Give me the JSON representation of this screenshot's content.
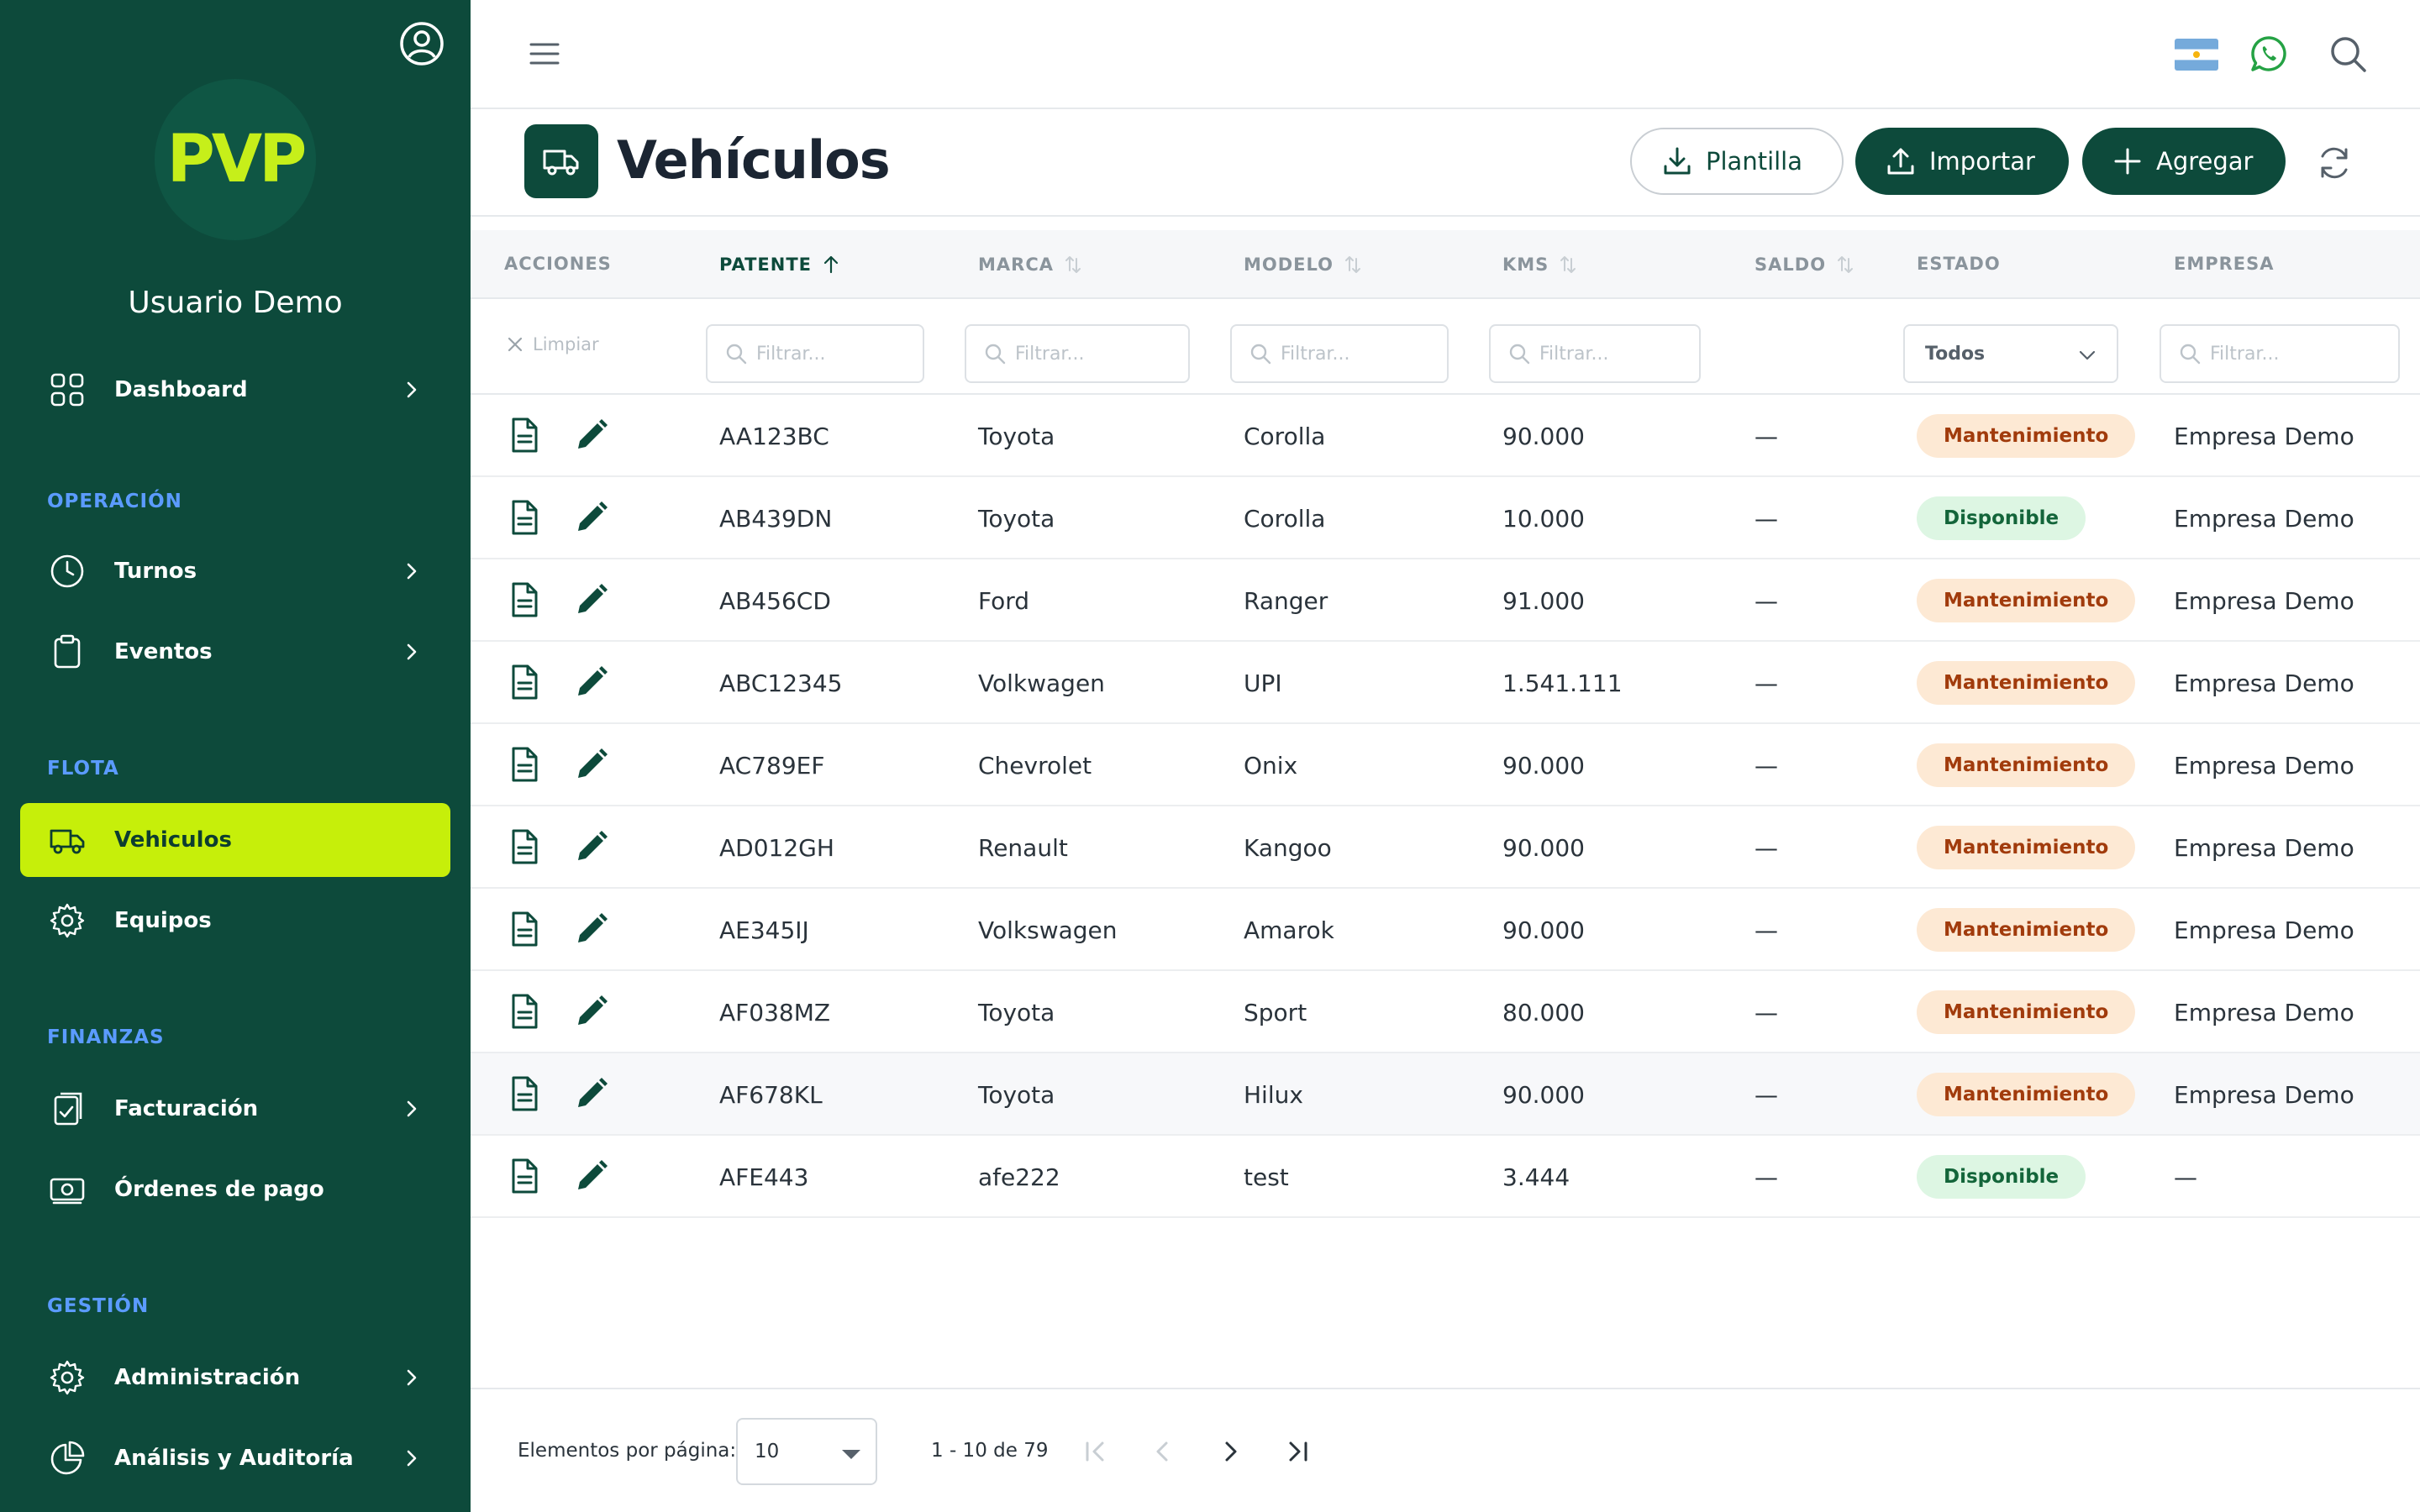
{
  "sidebar": {
    "logo_text": "PVP",
    "username": "Usuario Demo",
    "sections": {
      "operacion": "OPERACIÓN",
      "flota": "FLOTA",
      "finanzas": "FINANZAS",
      "gestion": "GESTIÓN"
    },
    "items": [
      {
        "label": "Dashboard",
        "icon": "grid-icon",
        "chevron": true
      },
      {
        "label": "Turnos",
        "icon": "clock-icon",
        "chevron": true
      },
      {
        "label": "Eventos",
        "icon": "clipboard-icon",
        "chevron": true
      },
      {
        "label": "Vehiculos",
        "icon": "truck-icon",
        "chevron": false,
        "active": true
      },
      {
        "label": "Equipos",
        "icon": "gear-icon",
        "chevron": false
      },
      {
        "label": "Facturación",
        "icon": "invoice-icon",
        "chevron": true
      },
      {
        "label": "Órdenes de pago",
        "icon": "money-icon",
        "chevron": false
      },
      {
        "label": "Administración",
        "icon": "gear-icon",
        "chevron": true
      },
      {
        "label": "Análisis y Auditoría",
        "icon": "pie-chart-icon",
        "chevron": true
      }
    ]
  },
  "header": {
    "title": "Vehículos",
    "buttons": {
      "plantilla": "Plantilla",
      "importar": "Importar",
      "agregar": "Agregar"
    }
  },
  "table": {
    "columns": {
      "acciones": "ACCIONES",
      "patente": "PATENTE",
      "marca": "MARCA",
      "modelo": "MODELO",
      "kms": "KMS",
      "saldo": "SALDO",
      "estado": "ESTADO",
      "empresa": "EMPRESA"
    },
    "filters": {
      "clear": "Limpiar",
      "placeholder": "Filtrar...",
      "estado_selected": "Todos"
    },
    "rows": [
      {
        "patente": "AA123BC",
        "marca": "Toyota",
        "modelo": "Corolla",
        "kms": "90.000",
        "saldo": "—",
        "estado": "Mantenimiento",
        "estado_kind": "mant",
        "empresa": "Empresa Demo"
      },
      {
        "patente": "AB439DN",
        "marca": "Toyota",
        "modelo": "Corolla",
        "kms": "10.000",
        "saldo": "—",
        "estado": "Disponible",
        "estado_kind": "disp",
        "empresa": "Empresa Demo"
      },
      {
        "patente": "AB456CD",
        "marca": "Ford",
        "modelo": "Ranger",
        "kms": "91.000",
        "saldo": "—",
        "estado": "Mantenimiento",
        "estado_kind": "mant",
        "empresa": "Empresa Demo"
      },
      {
        "patente": "ABC12345",
        "marca": "Volkwagen",
        "modelo": "UPI",
        "kms": "1.541.111",
        "saldo": "—",
        "estado": "Mantenimiento",
        "estado_kind": "mant",
        "empresa": "Empresa Demo"
      },
      {
        "patente": "AC789EF",
        "marca": "Chevrolet",
        "modelo": "Onix",
        "kms": "90.000",
        "saldo": "—",
        "estado": "Mantenimiento",
        "estado_kind": "mant",
        "empresa": "Empresa Demo"
      },
      {
        "patente": "AD012GH",
        "marca": "Renault",
        "modelo": "Kangoo",
        "kms": "90.000",
        "saldo": "—",
        "estado": "Mantenimiento",
        "estado_kind": "mant",
        "empresa": "Empresa Demo"
      },
      {
        "patente": "AE345IJ",
        "marca": "Volkswagen",
        "modelo": "Amarok",
        "kms": "90.000",
        "saldo": "—",
        "estado": "Mantenimiento",
        "estado_kind": "mant",
        "empresa": "Empresa Demo"
      },
      {
        "patente": "AF038MZ",
        "marca": "Toyota",
        "modelo": "Sport",
        "kms": "80.000",
        "saldo": "—",
        "estado": "Mantenimiento",
        "estado_kind": "mant",
        "empresa": "Empresa Demo"
      },
      {
        "patente": "AF678KL",
        "marca": "Toyota",
        "modelo": "Hilux",
        "kms": "90.000",
        "saldo": "—",
        "estado": "Mantenimiento",
        "estado_kind": "mant",
        "empresa": "Empresa Demo"
      },
      {
        "patente": "AFE443",
        "marca": "afe222",
        "modelo": "test",
        "kms": "3.444",
        "saldo": "—",
        "estado": "Disponible",
        "estado_kind": "disp",
        "empresa": "—"
      }
    ]
  },
  "footer": {
    "per_page_label": "Elementos por página:",
    "per_page_value": "10",
    "range": "1 - 10 de 79"
  },
  "colors": {
    "sidebar_bg": "#0d4a3b",
    "accent_lime": "#c6ef0a",
    "section_blue": "#5b9bff",
    "badge_mant_bg": "#fde9d4",
    "badge_disp_bg": "#ddf6e3"
  }
}
